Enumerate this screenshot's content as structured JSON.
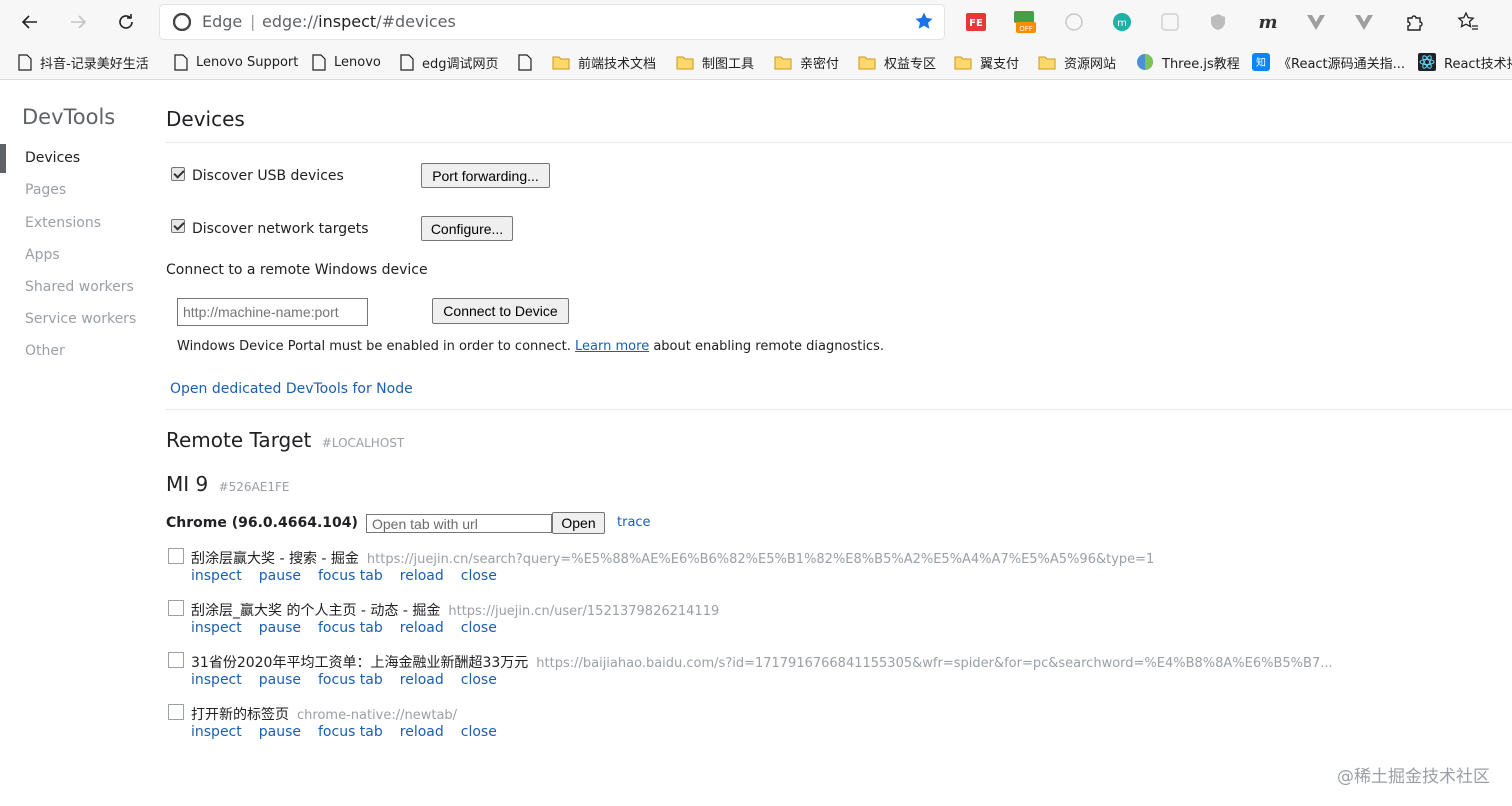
{
  "browser": {
    "site_name": "Edge",
    "url_prefix": "edge://",
    "url_host": "inspect",
    "url_rest": "/#devices"
  },
  "extensions": [
    {
      "name": "fe-extension-icon",
      "label": "FE"
    },
    {
      "name": "off-extension-icon",
      "label": "OFF"
    },
    {
      "name": "m-extension-icon",
      "label": "m"
    }
  ],
  "bookmarks": [
    {
      "label": "抖音-记录美好生活",
      "icon": "page-icon"
    },
    {
      "label": "Lenovo Support",
      "icon": "page-icon"
    },
    {
      "label": "Lenovo",
      "icon": "page-icon"
    },
    {
      "label": "edg调试网页",
      "icon": "page-icon"
    },
    {
      "label": "",
      "icon": "page-icon"
    },
    {
      "label": "前端技术文档",
      "icon": "folder-icon"
    },
    {
      "label": "制图工具",
      "icon": "folder-icon"
    },
    {
      "label": "亲密付",
      "icon": "folder-icon"
    },
    {
      "label": "权益专区",
      "icon": "folder-icon"
    },
    {
      "label": "翼支付",
      "icon": "folder-icon"
    },
    {
      "label": "资源网站",
      "icon": "folder-icon"
    },
    {
      "label": "Three.js教程",
      "icon": "threejs-icon"
    },
    {
      "label": "《React源码通关指...",
      "icon": "zhihu-icon"
    },
    {
      "label": "React技术揭",
      "icon": "react-icon"
    }
  ],
  "sidebar": {
    "title": "DevTools",
    "items": [
      {
        "label": "Devices",
        "active": true
      },
      {
        "label": "Pages",
        "active": false
      },
      {
        "label": "Extensions",
        "active": false
      },
      {
        "label": "Apps",
        "active": false
      },
      {
        "label": "Shared workers",
        "active": false
      },
      {
        "label": "Service workers",
        "active": false
      },
      {
        "label": "Other",
        "active": false
      }
    ]
  },
  "devices": {
    "title": "Devices",
    "discover_usb_label": "Discover USB devices",
    "discover_usb_checked": true,
    "port_forwarding_label": "Port forwarding...",
    "discover_network_label": "Discover network targets",
    "discover_network_checked": true,
    "configure_label": "Configure...",
    "remote_windows_label": "Connect to a remote Windows device",
    "machine_placeholder": "http://machine-name:port",
    "connect_button_label": "Connect to Device",
    "portal_note_before": "Windows Device Portal must be enabled in order to connect.",
    "portal_note_link": "Learn more",
    "portal_note_after": "about enabling remote diagnostics.",
    "node_devtools_link": "Open dedicated DevTools for Node"
  },
  "remote_target": {
    "title": "Remote Target",
    "subtitle": "#LOCALHOST",
    "device_name": "MI 9",
    "device_id": "#526AE1FE",
    "browser_label": "Chrome (96.0.4664.104)",
    "open_tab_placeholder": "Open tab with url",
    "open_button_label": "Open",
    "trace_link": "trace",
    "actions": [
      "inspect",
      "pause",
      "focus tab",
      "reload",
      "close"
    ],
    "tabs": [
      {
        "title": "刮涂层赢大奖 - 搜索 - 掘金",
        "url": "https://juejin.cn/search?query=%E5%88%AE%E6%B6%82%E5%B1%82%E8%B5%A2%E5%A4%A7%E5%A5%96&type=1"
      },
      {
        "title": "刮涂层_赢大奖 的个人主页 - 动态 - 掘金",
        "url": "https://juejin.cn/user/1521379826214119"
      },
      {
        "title": "31省份2020年平均工资单：上海金融业新酬超33万元",
        "url": "https://baijiahao.baidu.com/s?id=1717916766841155305&wfr=spider&for=pc&searchword=%E4%B8%8A%E6%B5%B7..."
      },
      {
        "title": "打开新的标签页",
        "url": "chrome-native://newtab/"
      }
    ]
  },
  "watermark": "@稀土掘金技术社区"
}
